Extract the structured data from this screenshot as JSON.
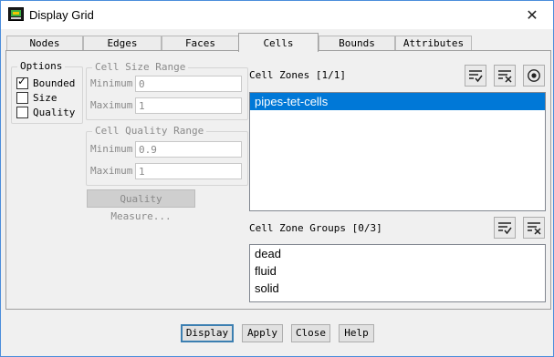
{
  "window": {
    "title": "Display Grid",
    "close_glyph": "✕"
  },
  "tabs": [
    {
      "label": "Nodes"
    },
    {
      "label": "Edges"
    },
    {
      "label": "Faces"
    },
    {
      "label": "Cells",
      "active": true
    },
    {
      "label": "Bounds"
    },
    {
      "label": "Attributes"
    }
  ],
  "options": {
    "title": "Options",
    "bounded": {
      "label": "Bounded",
      "checked": true
    },
    "size": {
      "label": "Size",
      "checked": false
    },
    "quality": {
      "label": "Quality",
      "checked": false
    }
  },
  "cell_size_range": {
    "title": "Cell Size Range",
    "minimum_label": "Minimum",
    "minimum_value": "0",
    "maximum_label": "Maximum",
    "maximum_value": "1"
  },
  "cell_quality_range": {
    "title": "Cell Quality Range",
    "minimum_label": "Minimum",
    "minimum_value": "0.9",
    "maximum_label": "Maximum",
    "maximum_value": "1"
  },
  "quality_measure_button": "Quality Measure...",
  "cell_zones": {
    "label": "Cell Zones [1/1]",
    "items": [
      "pipes-tet-cells"
    ],
    "selected_index": 0
  },
  "cell_zone_groups": {
    "label": "Cell Zone Groups [0/3]",
    "items": [
      "dead",
      "fluid",
      "solid"
    ]
  },
  "icons": [
    "select-all-icon",
    "deselect-all-icon",
    "radio-target-icon"
  ],
  "buttons": {
    "display": "Display",
    "apply": "Apply",
    "close": "Close",
    "help": "Help"
  },
  "colors": {
    "selection": "#0078d7",
    "window_border": "#4b8ddb"
  }
}
